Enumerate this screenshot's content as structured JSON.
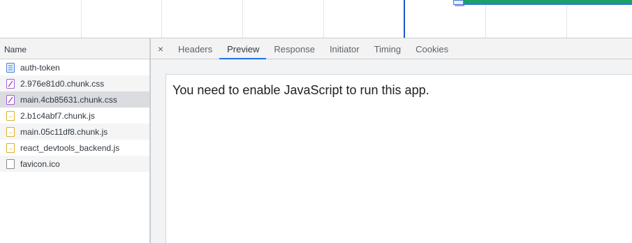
{
  "name_panel": {
    "header": "Name",
    "requests": [
      {
        "name": "auth-token",
        "icon": "document-icon"
      },
      {
        "name": "2.976e81d0.chunk.css",
        "icon": "stylesheet-icon"
      },
      {
        "name": "main.4cb85631.chunk.css",
        "icon": "stylesheet-icon"
      },
      {
        "name": "2.b1c4abf7.chunk.js",
        "icon": "script-icon"
      },
      {
        "name": "main.05c11df8.chunk.js",
        "icon": "script-icon"
      },
      {
        "name": "react_devtools_backend.js",
        "icon": "script-icon"
      },
      {
        "name": "favicon.ico",
        "icon": "file-icon"
      }
    ]
  },
  "detail": {
    "close_label": "×",
    "tabs": [
      "Headers",
      "Preview",
      "Response",
      "Initiator",
      "Timing",
      "Cookies"
    ],
    "active_tab": "Preview",
    "preview_text": "You need to enable JavaScript to run this app."
  },
  "colors": {
    "accent": "#1a73e8",
    "document_icon": "#4a7fd4",
    "stylesheet_icon": "#a05fd4",
    "script_icon": "#e0b020"
  }
}
